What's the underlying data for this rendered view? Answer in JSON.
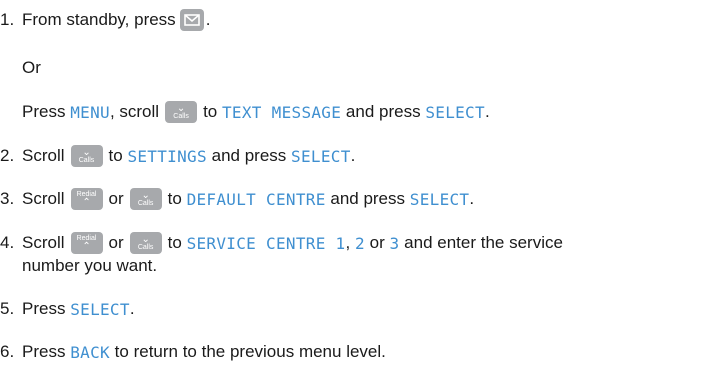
{
  "steps": [
    {
      "number": "1.",
      "text1": "From standby, press",
      "text2": ".",
      "icon": "envelope-key-icon",
      "or": "Or",
      "alt": {
        "text1": "Press",
        "menu": "MENU",
        "text2": ", scroll",
        "key_down_label": "Calls",
        "text3": "to",
        "target": "TEXT MESSAGE",
        "text4": "and press",
        "select": "SELECT",
        "text5": "."
      }
    },
    {
      "number": "2.",
      "text1": "Scroll",
      "key_down_label": "Calls",
      "text2": "to",
      "target": "SETTINGS",
      "text3": "and press",
      "select": "SELECT",
      "text4": "."
    },
    {
      "number": "3.",
      "text1": "Scroll",
      "key_up_label": "Redial",
      "or": "or",
      "key_down_label": "Calls",
      "text2": "to",
      "target": "DEFAULT CENTRE",
      "text3": "and press",
      "select": "SELECT",
      "text4": "."
    },
    {
      "number": "4.",
      "text1": "Scroll",
      "key_up_label": "Redial",
      "or": "or",
      "key_down_label": "Calls",
      "text2": "to",
      "target": "SERVICE CENTRE 1",
      "comma": ",",
      "opt2": "2",
      "or2": "or",
      "opt3": "3",
      "text3": "and enter the service",
      "text4": "number you want."
    },
    {
      "number": "5.",
      "text1": "Press",
      "select": "SELECT",
      "text2": "."
    },
    {
      "number": "6.",
      "text1": "Press",
      "back": "BACK",
      "text2": "to return to the previous menu level."
    }
  ],
  "colors": {
    "lcd_text": "#3f8fd0",
    "key_bg": "#a7a9ac",
    "body_text": "#1a1a1a"
  }
}
